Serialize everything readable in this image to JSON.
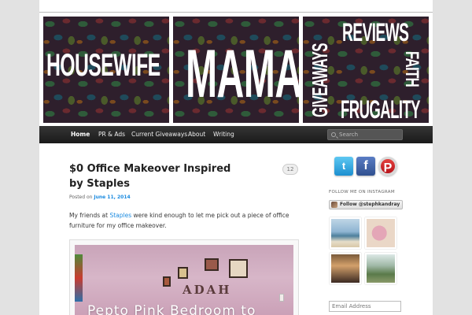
{
  "header": {
    "panel_1_text": "HOUSEWIFE",
    "panel_2_text": "MAMA",
    "panel_3_words": {
      "reviews": "REVIEWS",
      "giveaways": "GIVEAWAYS",
      "faith": "FAITH",
      "frugality": "FRUGALITY"
    }
  },
  "nav": {
    "items": [
      {
        "label": "Home",
        "active": true
      },
      {
        "label": "PR & Ads"
      },
      {
        "label": "Current Giveaways"
      },
      {
        "label": "About"
      },
      {
        "label": "Writing"
      }
    ],
    "search_placeholder": "Search"
  },
  "post": {
    "title": "$0 Office Makeover Inspired by Staples",
    "comment_count": "12",
    "posted_on_label": "Posted on",
    "date": "June 11, 2014",
    "body_before": "My friends at ",
    "body_link": "Staples",
    "body_after": " were kind enough to let me pick out a piece of office furniture for my office makeover.",
    "image_name_text": "ADAH",
    "image_caption": "Pepto Pink Bedroom to"
  },
  "sidebar": {
    "social": [
      {
        "name": "twitter",
        "glyph": "t",
        "color": "#1c8fd0"
      },
      {
        "name": "facebook",
        "glyph": "f",
        "color": "#30508f"
      },
      {
        "name": "pinterest",
        "glyph": "P",
        "color": "#b8131a"
      }
    ],
    "instagram_heading": "FOLLOW ME ON INSTAGRAM",
    "instagram_button": "Follow @stephkandray",
    "email_placeholder": "Email Address"
  },
  "colors": {
    "link": "#1b8be0",
    "nav_bg": "#1a1a1a",
    "page_bg": "#e2e2e2"
  }
}
